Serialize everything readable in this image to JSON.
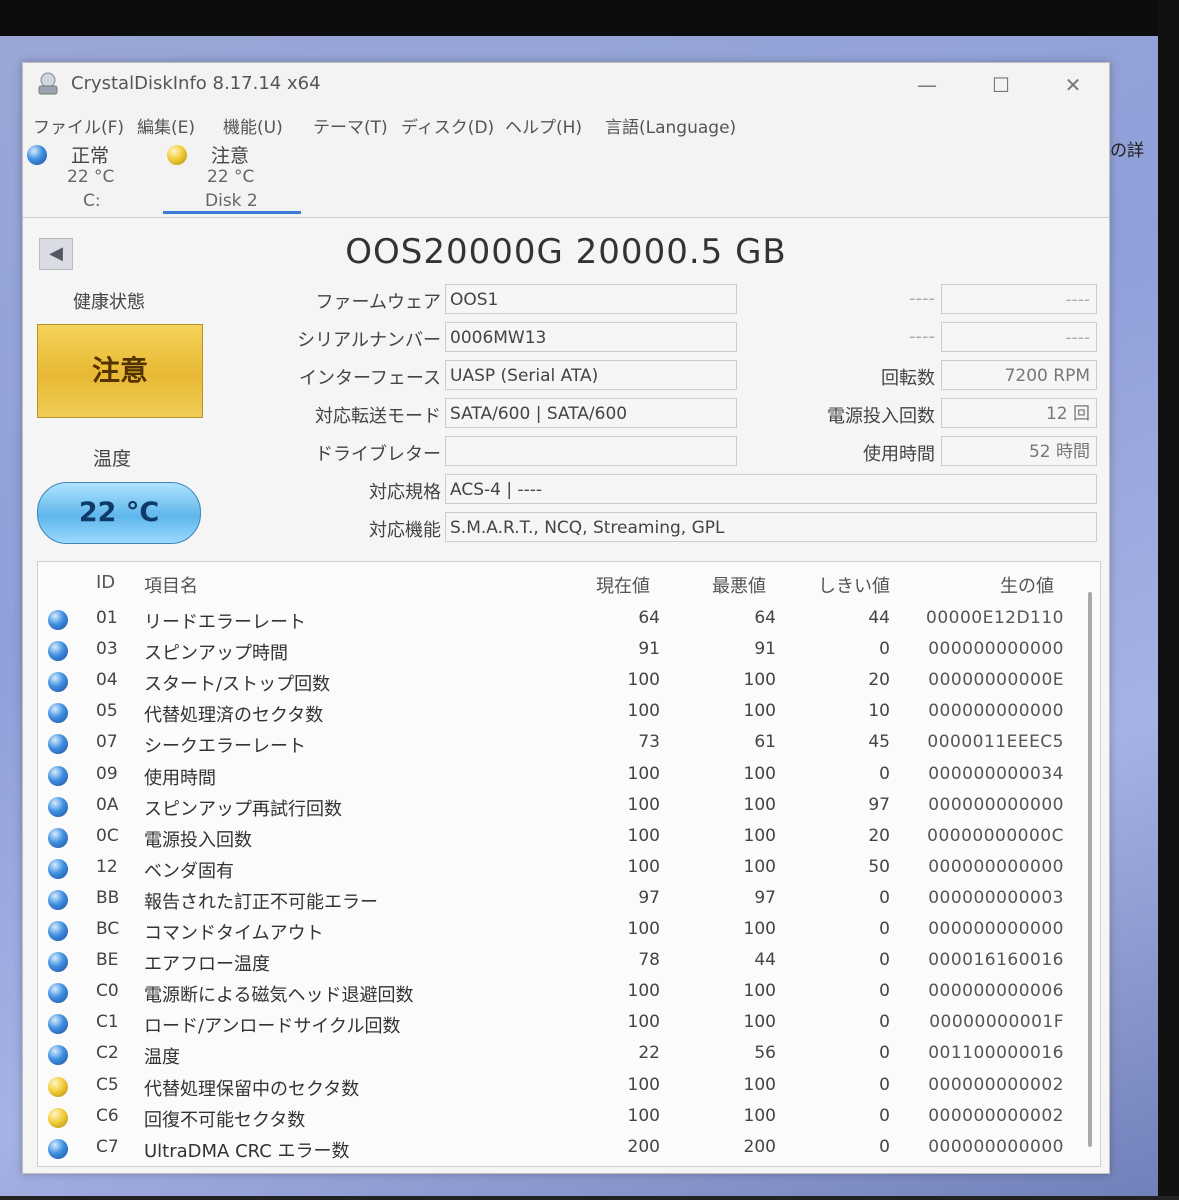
{
  "background": {
    "right_text": "の詳"
  },
  "window": {
    "title": "CrystalDiskInfo 8.17.14 x64"
  },
  "menu": [
    "ファイル(F)",
    "編集(E)",
    "機能(U)",
    "テーマ(T)",
    "ディスク(D)",
    "ヘルプ(H)",
    "言語(Language)"
  ],
  "disks": [
    {
      "status": "正常",
      "temp": "22 °C",
      "drive": "C:",
      "color": "blue"
    },
    {
      "status": "注意",
      "temp": "22 °C",
      "drive": "Disk 2",
      "color": "yellow"
    }
  ],
  "model": "OOS20000G 20000.5 GB",
  "health": {
    "label": "健康状態",
    "value": "注意"
  },
  "temperature": {
    "label": "温度",
    "value": "22 °C"
  },
  "info": {
    "firmware_label": "ファームウェア",
    "firmware": "OOS1",
    "serial_label": "シリアルナンバー",
    "serial": "0006MW13",
    "interface_label": "インターフェース",
    "interface": "UASP (Serial ATA)",
    "transfer_label": "対応転送モード",
    "transfer": "SATA/600 | SATA/600",
    "drive_letter_label": "ドライブレター",
    "drive_letter": "",
    "standard_label": "対応規格",
    "standard": "ACS-4 | ----",
    "features_label": "対応機能",
    "features": "S.M.A.R.T., NCQ, Streaming, GPL",
    "right_dash_1a": "----",
    "right_dash_1b": "----",
    "right_dash_2a": "----",
    "right_dash_2b": "----",
    "rotation_label": "回転数",
    "rotation": "7200 RPM",
    "power_on_count_label": "電源投入回数",
    "power_on_count": "12 回",
    "power_on_hours_label": "使用時間",
    "power_on_hours": "52 時間"
  },
  "smart_headers": {
    "id": "ID",
    "name": "項目名",
    "current": "現在値",
    "worst": "最悪値",
    "threshold": "しきい値",
    "raw": "生の値"
  },
  "smart_rows": [
    {
      "status": "blue",
      "id": "01",
      "name": "リードエラーレート",
      "current": "64",
      "worst": "64",
      "threshold": "44",
      "raw": "00000E12D110"
    },
    {
      "status": "blue",
      "id": "03",
      "name": "スピンアップ時間",
      "current": "91",
      "worst": "91",
      "threshold": "0",
      "raw": "000000000000"
    },
    {
      "status": "blue",
      "id": "04",
      "name": "スタート/ストップ回数",
      "current": "100",
      "worst": "100",
      "threshold": "20",
      "raw": "00000000000E"
    },
    {
      "status": "blue",
      "id": "05",
      "name": "代替処理済のセクタ数",
      "current": "100",
      "worst": "100",
      "threshold": "10",
      "raw": "000000000000"
    },
    {
      "status": "blue",
      "id": "07",
      "name": "シークエラーレート",
      "current": "73",
      "worst": "61",
      "threshold": "45",
      "raw": "0000011EEEC5"
    },
    {
      "status": "blue",
      "id": "09",
      "name": "使用時間",
      "current": "100",
      "worst": "100",
      "threshold": "0",
      "raw": "000000000034"
    },
    {
      "status": "blue",
      "id": "0A",
      "name": "スピンアップ再試行回数",
      "current": "100",
      "worst": "100",
      "threshold": "97",
      "raw": "000000000000"
    },
    {
      "status": "blue",
      "id": "0C",
      "name": "電源投入回数",
      "current": "100",
      "worst": "100",
      "threshold": "20",
      "raw": "00000000000C"
    },
    {
      "status": "blue",
      "id": "12",
      "name": "ベンダ固有",
      "current": "100",
      "worst": "100",
      "threshold": "50",
      "raw": "000000000000"
    },
    {
      "status": "blue",
      "id": "BB",
      "name": "報告された訂正不可能エラー",
      "current": "97",
      "worst": "97",
      "threshold": "0",
      "raw": "000000000003"
    },
    {
      "status": "blue",
      "id": "BC",
      "name": "コマンドタイムアウト",
      "current": "100",
      "worst": "100",
      "threshold": "0",
      "raw": "000000000000"
    },
    {
      "status": "blue",
      "id": "BE",
      "name": "エアフロー温度",
      "current": "78",
      "worst": "44",
      "threshold": "0",
      "raw": "000016160016"
    },
    {
      "status": "blue",
      "id": "C0",
      "name": "電源断による磁気ヘッド退避回数",
      "current": "100",
      "worst": "100",
      "threshold": "0",
      "raw": "000000000006"
    },
    {
      "status": "blue",
      "id": "C1",
      "name": "ロード/アンロードサイクル回数",
      "current": "100",
      "worst": "100",
      "threshold": "0",
      "raw": "00000000001F"
    },
    {
      "status": "blue",
      "id": "C2",
      "name": "温度",
      "current": "22",
      "worst": "56",
      "threshold": "0",
      "raw": "001100000016"
    },
    {
      "status": "yellow",
      "id": "C5",
      "name": "代替処理保留中のセクタ数",
      "current": "100",
      "worst": "100",
      "threshold": "0",
      "raw": "000000000002"
    },
    {
      "status": "yellow",
      "id": "C6",
      "name": "回復不可能セクタ数",
      "current": "100",
      "worst": "100",
      "threshold": "0",
      "raw": "000000000002"
    },
    {
      "status": "blue",
      "id": "C7",
      "name": "UltraDMA CRC エラー数",
      "current": "200",
      "worst": "200",
      "threshold": "0",
      "raw": "000000000000"
    }
  ]
}
